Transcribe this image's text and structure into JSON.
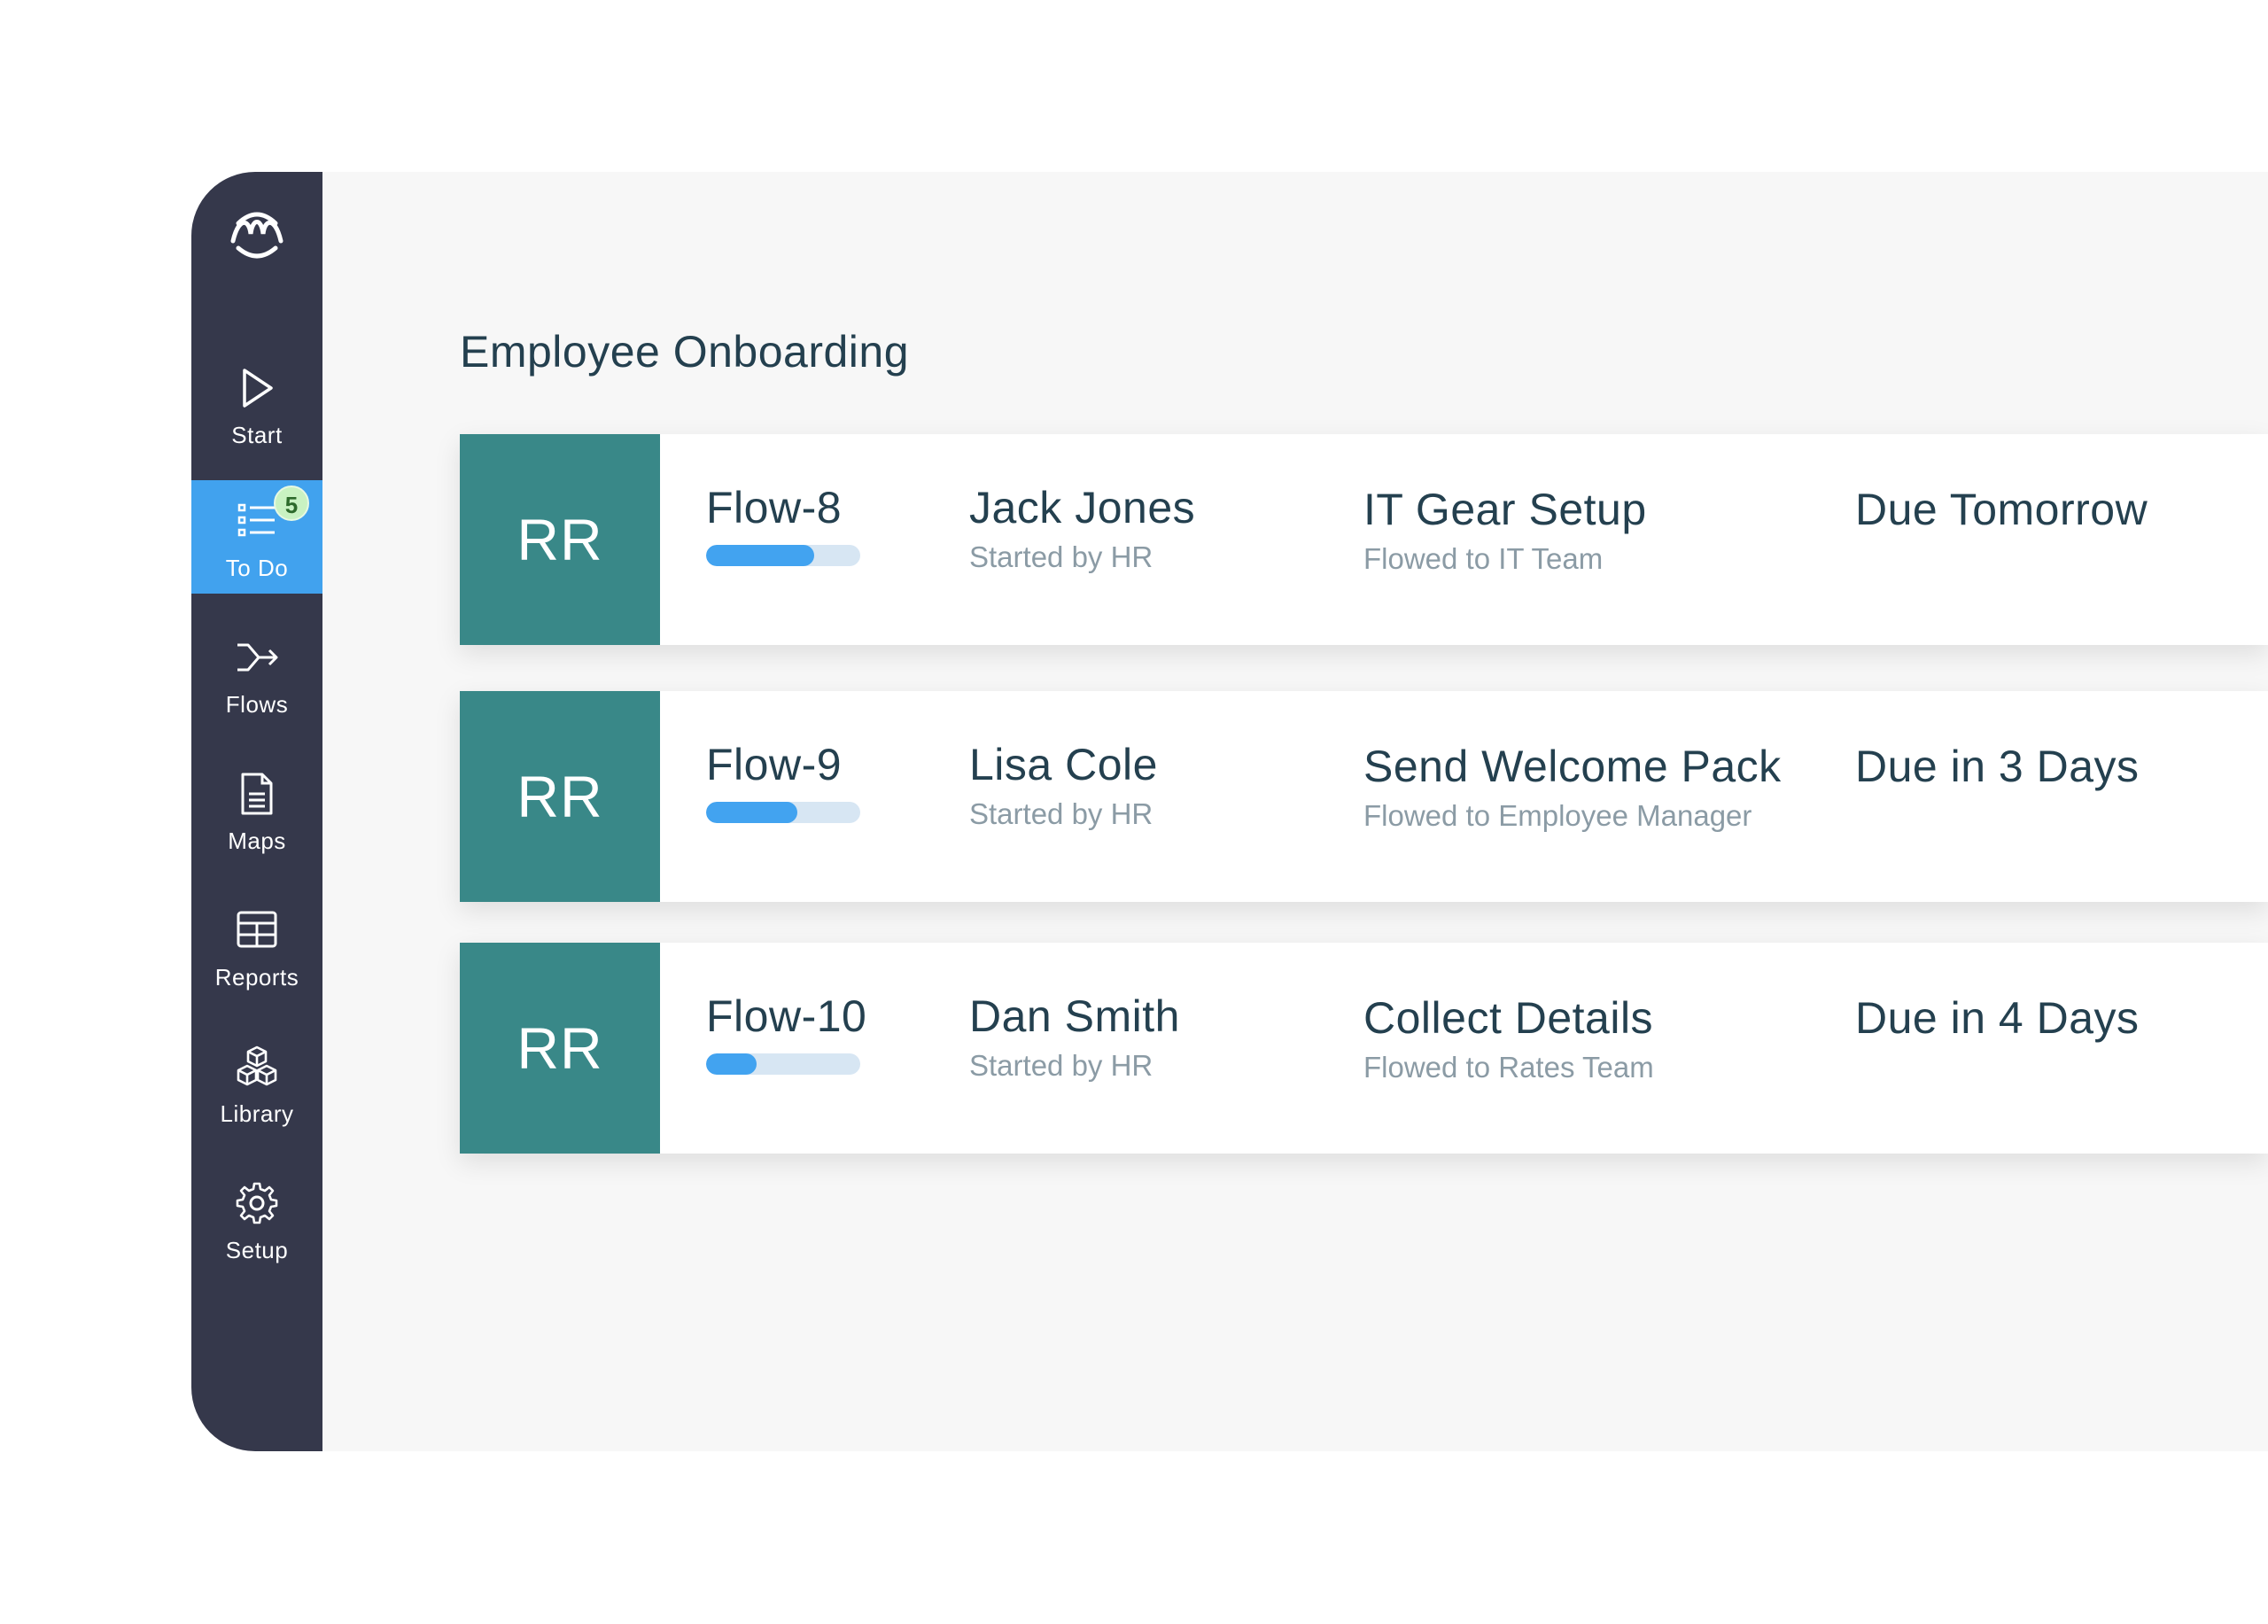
{
  "sidebar": {
    "logo": "wave-logo",
    "items": [
      {
        "label": "Start",
        "icon": "play-icon"
      },
      {
        "label": "To Do",
        "icon": "checklist-icon",
        "badge": "5",
        "active": true
      },
      {
        "label": "Flows",
        "icon": "flow-arrow-icon"
      },
      {
        "label": "Maps",
        "icon": "document-icon"
      },
      {
        "label": "Reports",
        "icon": "table-icon"
      },
      {
        "label": "Library",
        "icon": "boxes-icon"
      },
      {
        "label": "Setup",
        "icon": "gear-icon"
      }
    ]
  },
  "main": {
    "title": "Employee Onboarding",
    "cards": [
      {
        "avatar": "RR",
        "flow": "Flow-8",
        "progress": 0.7,
        "person": "Jack Jones",
        "started_by": "Started by HR",
        "task": "IT Gear Setup",
        "flowed_to": "Flowed to IT Team",
        "due": "Due Tomorrow"
      },
      {
        "avatar": "RR",
        "flow": "Flow-9",
        "progress": 0.59,
        "person": "Lisa Cole",
        "started_by": "Started by HR",
        "task": "Send Welcome Pack",
        "flowed_to": "Flowed to Employee Manager",
        "due": "Due in 3 Days"
      },
      {
        "avatar": "RR",
        "flow": "Flow-10",
        "progress": 0.33,
        "person": "Dan Smith",
        "started_by": "Started by HR",
        "task": "Collect Details",
        "flowed_to": "Flowed to Rates Team",
        "due": "Due in 4 Days"
      }
    ]
  },
  "colors": {
    "sidebar_bg": "#35384b",
    "active_item": "#41a2ee",
    "avatar_bg": "#398888",
    "progress_fill": "#42a3f0",
    "progress_track": "#d7e6f3",
    "badge_bg": "#c9f2c2",
    "text_primary": "#24404f",
    "text_secondary": "#8b9ba5"
  }
}
